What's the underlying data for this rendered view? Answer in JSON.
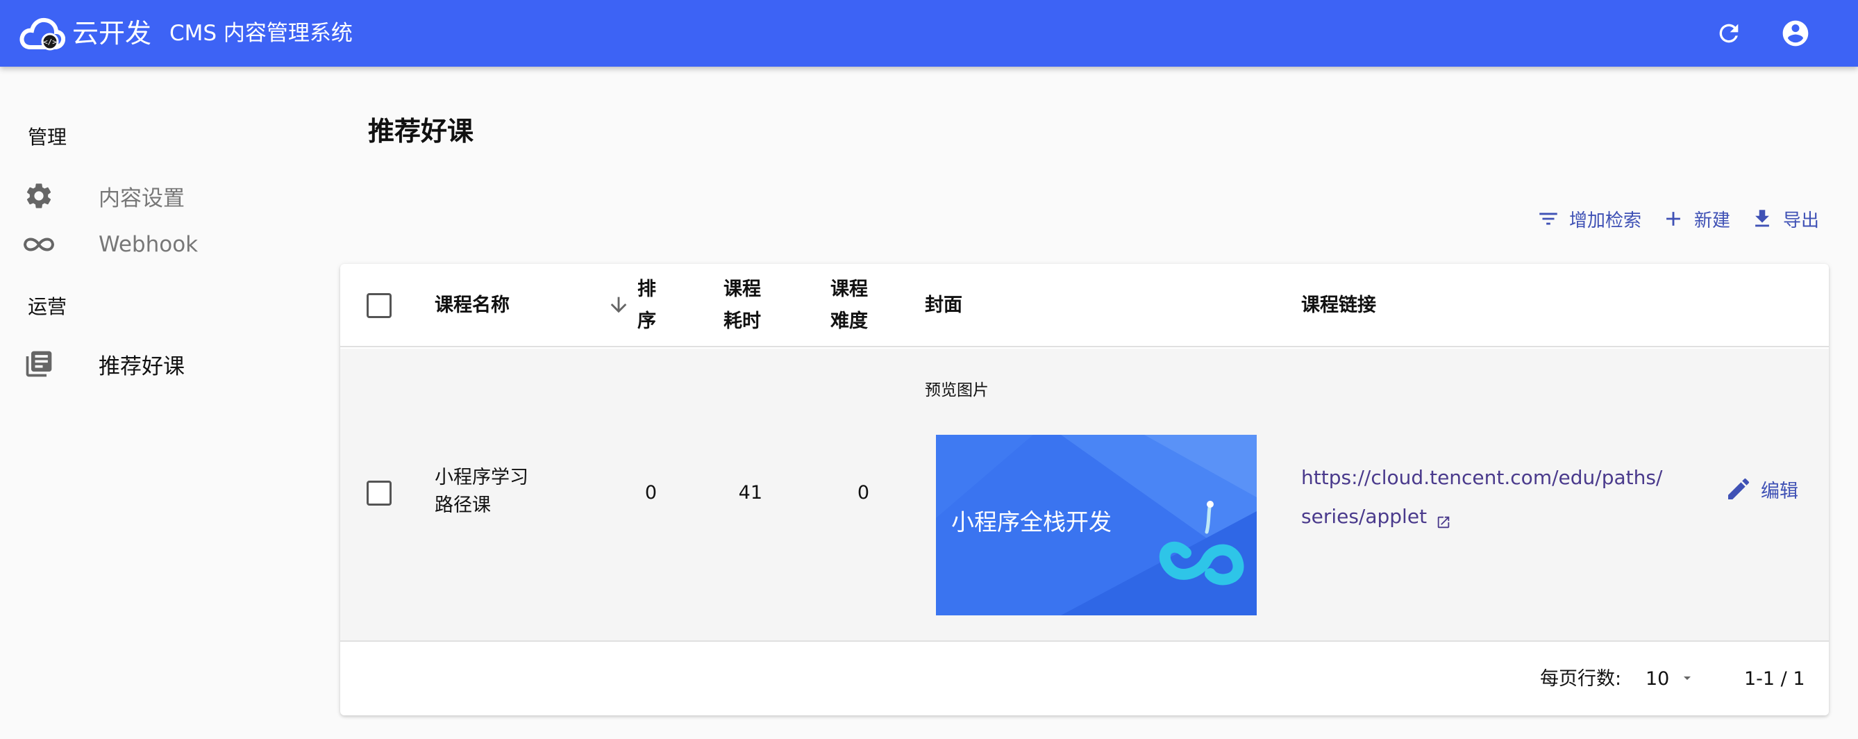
{
  "header": {
    "brand": "云开发",
    "system_title": "CMS 内容管理系统",
    "icons": {
      "logo": "cloud-logo-icon",
      "refresh": "refresh-icon",
      "account": "account-circle-icon"
    },
    "color": "#3d63f5"
  },
  "sidebar": {
    "sections": [
      {
        "title": "管理",
        "items": [
          {
            "label": "内容设置",
            "icon": "gear-icon"
          },
          {
            "label": "Webhook",
            "icon": "webhook-icon"
          }
        ]
      },
      {
        "title": "运营",
        "items": [
          {
            "label": "推荐好课",
            "icon": "library-books-icon"
          }
        ]
      }
    ]
  },
  "page": {
    "title": "推荐好课"
  },
  "toolbar": {
    "add_search": "增加检索",
    "new": "新建",
    "export": "导出"
  },
  "table": {
    "headers": {
      "name": "课程名称",
      "sort_line1": "排",
      "sort_line2": "序",
      "duration_line1": "课程",
      "duration_line2": "耗时",
      "difficulty_line1": "课程",
      "difficulty_line2": "难度",
      "cover": "封面",
      "link": "课程链接"
    },
    "rows": [
      {
        "name_line1": "小程序学习",
        "name_line2": "路径课",
        "sort": "0",
        "duration": "41",
        "difficulty": "0",
        "cover_caption": "预览图片",
        "cover_text": "小程序全栈开发",
        "link": "https://cloud.tencent.com/edu/paths/series/applet",
        "edit": "编辑"
      }
    ],
    "footer": {
      "rows_per_page_label": "每页行数:",
      "rows_per_page": "10",
      "range": "1-1 / 1"
    }
  },
  "accent_color": "#3f51b5"
}
